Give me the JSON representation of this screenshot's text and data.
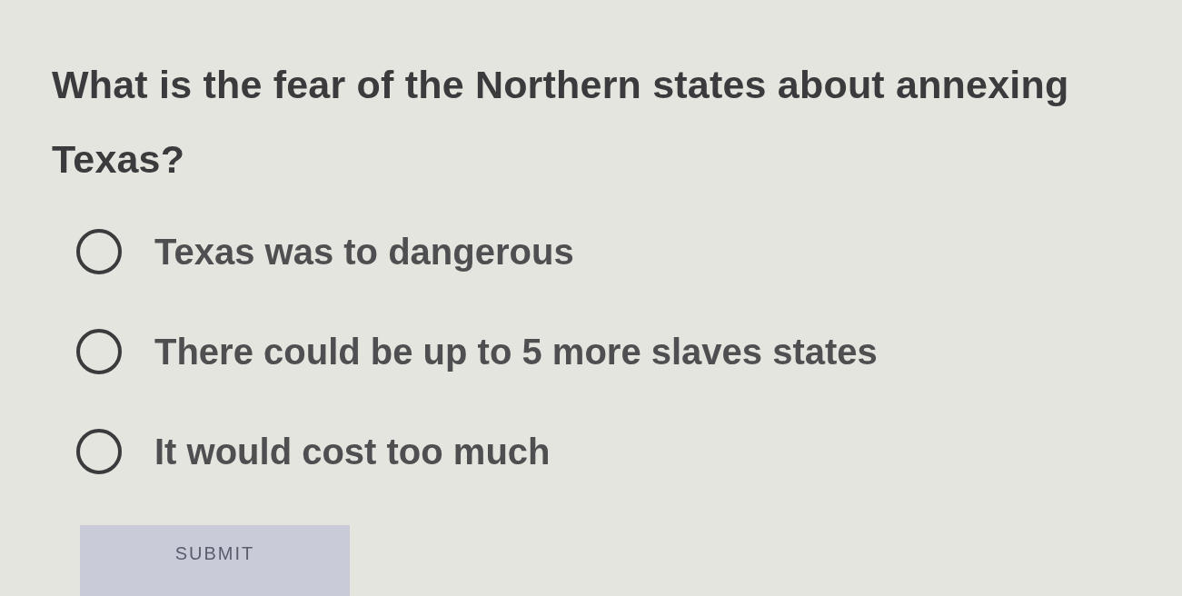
{
  "question": "What is the fear of the Northern states about annexing Texas?",
  "options": [
    {
      "label": "Texas was to dangerous",
      "selected": false
    },
    {
      "label": "There could be up to 5 more slaves states",
      "selected": false
    },
    {
      "label": "It would cost too much",
      "selected": false
    }
  ],
  "submit": {
    "label": "SUBMIT",
    "disabled": true
  }
}
